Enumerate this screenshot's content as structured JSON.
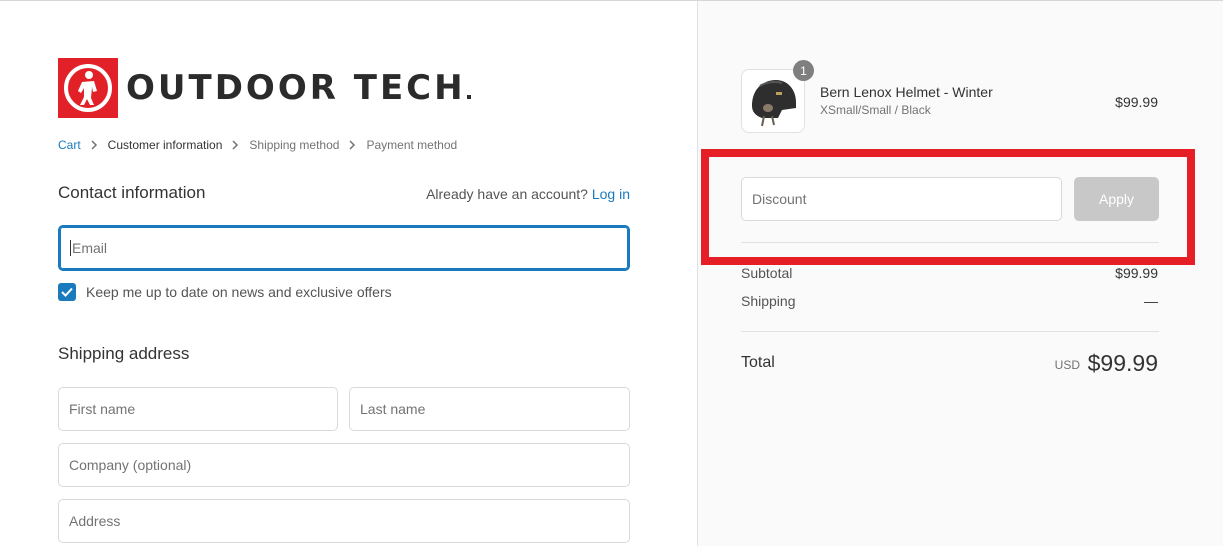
{
  "brand": {
    "name": "OUTDOOR TECH",
    "accent_color": "#e12127",
    "link_color": "#197bbd"
  },
  "breadcrumb": {
    "items": [
      "Cart",
      "Customer information",
      "Shipping method",
      "Payment method"
    ]
  },
  "contact": {
    "title": "Contact information",
    "account_prompt": "Already have an account?",
    "login_label": "Log in",
    "email_placeholder": "Email",
    "newsletter_label": "Keep me up to date on news and exclusive offers",
    "newsletter_checked": true
  },
  "shipping": {
    "title": "Shipping address",
    "first_name_placeholder": "First name",
    "last_name_placeholder": "Last name",
    "company_placeholder": "Company (optional)",
    "address_placeholder": "Address"
  },
  "order": {
    "product": {
      "name": "Bern Lenox Helmet - Winter",
      "variant": "XSmall/Small / Black",
      "price": "$99.99",
      "quantity": "1",
      "image_icon": "helmet-icon"
    },
    "discount_placeholder": "Discount",
    "apply_label": "Apply",
    "subtotal_label": "Subtotal",
    "subtotal_value": "$99.99",
    "shipping_label": "Shipping",
    "shipping_value": "—",
    "total_label": "Total",
    "currency": "USD",
    "total_value": "$99.99"
  }
}
